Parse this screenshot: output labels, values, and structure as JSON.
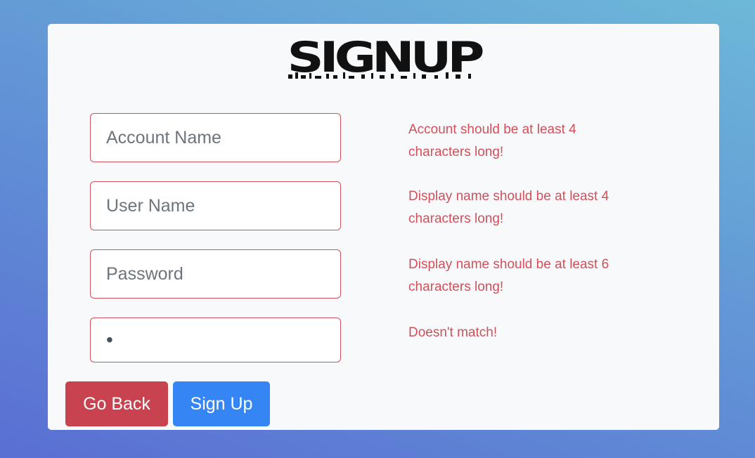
{
  "logo": {
    "text": "SIGNUP",
    "color": "#111111"
  },
  "form": {
    "account_name": {
      "placeholder": "Account Name",
      "value": ""
    },
    "user_name": {
      "placeholder": "User Name",
      "value": ""
    },
    "password": {
      "placeholder": "Password",
      "value": ""
    },
    "confirm_password": {
      "placeholder": "",
      "value": "x"
    }
  },
  "errors": {
    "account_name": "Account should be at least 4 characters long!",
    "user_name": "Display name should be at least 4 characters long!",
    "password": "Display name should be at least 6 characters long!",
    "confirm_password": "Doesn't match!"
  },
  "buttons": {
    "go_back": "Go Back",
    "sign_up": "Sign Up"
  },
  "colors": {
    "error": "#d0505b",
    "primary": "#3585f5",
    "danger": "#c9424f",
    "card": "#f8f9fa"
  }
}
